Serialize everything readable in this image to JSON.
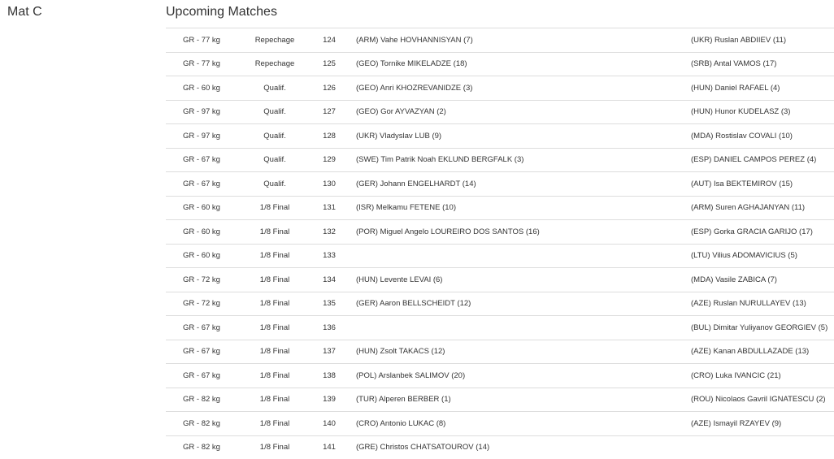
{
  "mat": {
    "title": "Mat C"
  },
  "section": {
    "title": "Upcoming Matches"
  },
  "matches": [
    {
      "weight": "GR - 77 kg",
      "round": "Repechage",
      "number": "124",
      "red": "(ARM) Vahe HOVHANNISYAN (7)",
      "blue": "(UKR) Ruslan ABDIIEV (11)"
    },
    {
      "weight": "GR - 77 kg",
      "round": "Repechage",
      "number": "125",
      "red": "(GEO) Tornike MIKELADZE (18)",
      "blue": "(SRB) Antal VAMOS (17)"
    },
    {
      "weight": "GR - 60 kg",
      "round": "Qualif.",
      "number": "126",
      "red": "(GEO) Anri KHOZREVANIDZE (3)",
      "blue": "(HUN) Daniel RAFAEL (4)"
    },
    {
      "weight": "GR - 97 kg",
      "round": "Qualif.",
      "number": "127",
      "red": "(GEO) Gor AYVAZYAN (2)",
      "blue": "(HUN) Hunor KUDELASZ (3)"
    },
    {
      "weight": "GR - 97 kg",
      "round": "Qualif.",
      "number": "128",
      "red": "(UKR) Vladyslav LUB (9)",
      "blue": "(MDA) Rostislav COVALI (10)"
    },
    {
      "weight": "GR - 67 kg",
      "round": "Qualif.",
      "number": "129",
      "red": "(SWE) Tim Patrik Noah EKLUND BERGFALK (3)",
      "blue": "(ESP) DANIEL CAMPOS PEREZ (4)"
    },
    {
      "weight": "GR - 67 kg",
      "round": "Qualif.",
      "number": "130",
      "red": "(GER) Johann ENGELHARDT (14)",
      "blue": "(AUT) Isa BEKTEMIROV (15)"
    },
    {
      "weight": "GR - 60 kg",
      "round": "1/8 Final",
      "number": "131",
      "red": "(ISR) Melkamu FETENE (10)",
      "blue": "(ARM) Suren AGHAJANYAN (11)"
    },
    {
      "weight": "GR - 60 kg",
      "round": "1/8 Final",
      "number": "132",
      "red": "(POR) Miguel Angelo LOUREIRO DOS SANTOS (16)",
      "blue": "(ESP) Gorka GRACIA GARIJO (17)"
    },
    {
      "weight": "GR - 60 kg",
      "round": "1/8 Final",
      "number": "133",
      "red": "",
      "blue": "(LTU) Vilius ADOMAVICIUS (5)"
    },
    {
      "weight": "GR - 72 kg",
      "round": "1/8 Final",
      "number": "134",
      "red": "(HUN) Levente LEVAI (6)",
      "blue": "(MDA) Vasile ZABICA (7)"
    },
    {
      "weight": "GR - 72 kg",
      "round": "1/8 Final",
      "number": "135",
      "red": "(GER) Aaron BELLSCHEIDT (12)",
      "blue": "(AZE) Ruslan NURULLAYEV (13)"
    },
    {
      "weight": "GR - 67 kg",
      "round": "1/8 Final",
      "number": "136",
      "red": "",
      "blue": "(BUL) Dimitar Yuliyanov GEORGIEV (5)"
    },
    {
      "weight": "GR - 67 kg",
      "round": "1/8 Final",
      "number": "137",
      "red": "(HUN) Zsolt TAKACS (12)",
      "blue": "(AZE) Kanan ABDULLAZADE (13)"
    },
    {
      "weight": "GR - 67 kg",
      "round": "1/8 Final",
      "number": "138",
      "red": "(POL) Arslanbek SALIMOV (20)",
      "blue": "(CRO) Luka IVANCIC (21)"
    },
    {
      "weight": "GR - 82 kg",
      "round": "1/8 Final",
      "number": "139",
      "red": "(TUR) Alperen BERBER (1)",
      "blue": "(ROU) Nicolaos Gavril IGNATESCU (2)"
    },
    {
      "weight": "GR - 82 kg",
      "round": "1/8 Final",
      "number": "140",
      "red": "(CRO) Antonio LUKAC (8)",
      "blue": "(AZE) Ismayil RZAYEV (9)"
    },
    {
      "weight": "GR - 82 kg",
      "round": "1/8 Final",
      "number": "141",
      "red": "(GRE) Christos CHATSATOUROV (14)",
      "blue": ""
    }
  ]
}
